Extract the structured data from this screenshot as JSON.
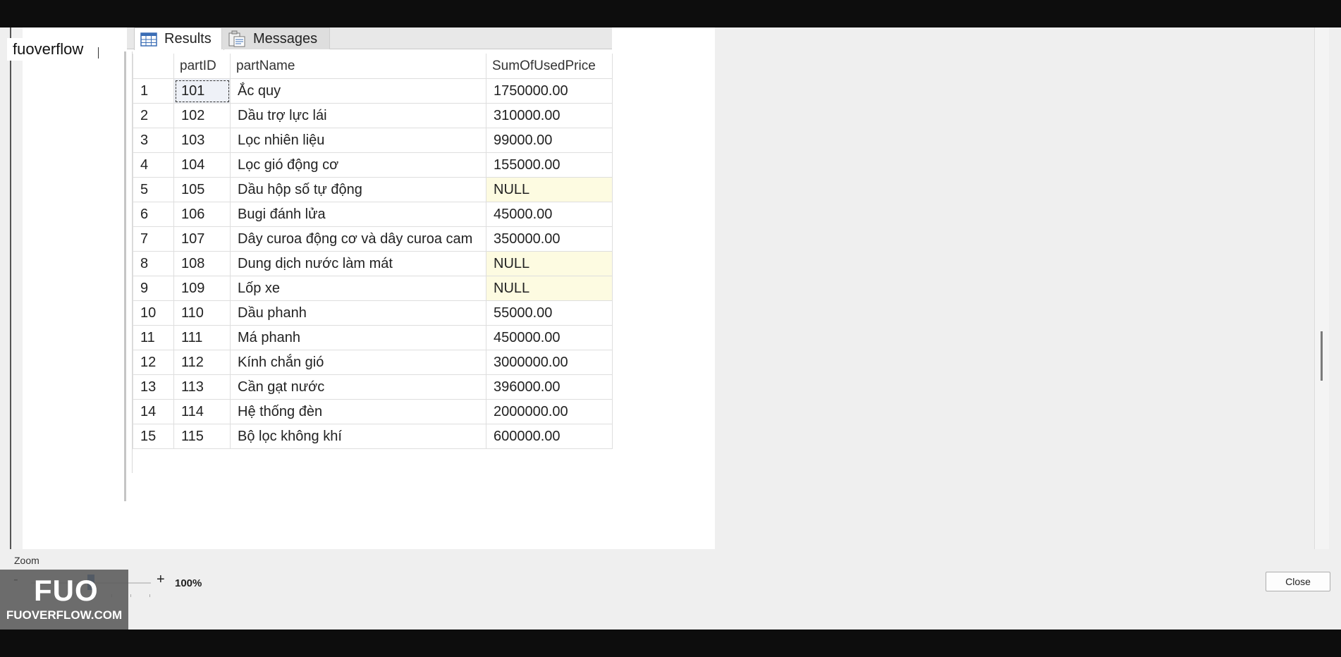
{
  "brand": {
    "text": "fuoverflow"
  },
  "tabs": [
    {
      "label": "Results",
      "icon": "grid-icon"
    },
    {
      "label": "Messages",
      "icon": "messages-icon"
    }
  ],
  "grid": {
    "columns": [
      "",
      "partID",
      "partName",
      "SumOfUsedPrice"
    ],
    "rows": [
      [
        "1",
        "101",
        "Ắc quy",
        "1750000.00"
      ],
      [
        "2",
        "102",
        "Dầu trợ lực lái",
        "310000.00"
      ],
      [
        "3",
        "103",
        "Lọc nhiên liệu",
        "99000.00"
      ],
      [
        "4",
        "104",
        "Lọc gió động cơ",
        "155000.00"
      ],
      [
        "5",
        "105",
        "Dầu hộp số tự động",
        "NULL"
      ],
      [
        "6",
        "106",
        "Bugi đánh lửa",
        "45000.00"
      ],
      [
        "7",
        "107",
        "Dây curoa động cơ và dây curoa cam",
        "350000.00"
      ],
      [
        "8",
        "108",
        "Dung dịch nước làm mát",
        "NULL"
      ],
      [
        "9",
        "109",
        "Lốp xe",
        "NULL"
      ],
      [
        "10",
        "110",
        "Dầu phanh",
        "55000.00"
      ],
      [
        "11",
        "111",
        "Má phanh",
        "450000.00"
      ],
      [
        "12",
        "112",
        "Kính chắn gió",
        "3000000.00"
      ],
      [
        "13",
        "113",
        "Cần gạt nước",
        "396000.00"
      ],
      [
        "14",
        "114",
        "Hệ thống đèn",
        "2000000.00"
      ],
      [
        "15",
        "115",
        "Bộ lọc không khí",
        "600000.00"
      ]
    ]
  },
  "zoom": {
    "label": "Zoom",
    "minus": "-",
    "plus": "+",
    "value": "100%",
    "level": 0.5
  },
  "logo": {
    "mark": "FUO",
    "domain": "FUOVERFLOW.COM"
  },
  "buttons": {
    "close": "Close"
  },
  "colors": {
    "null_cell": "#fdfbe1",
    "accent": "#1f5fa8"
  }
}
